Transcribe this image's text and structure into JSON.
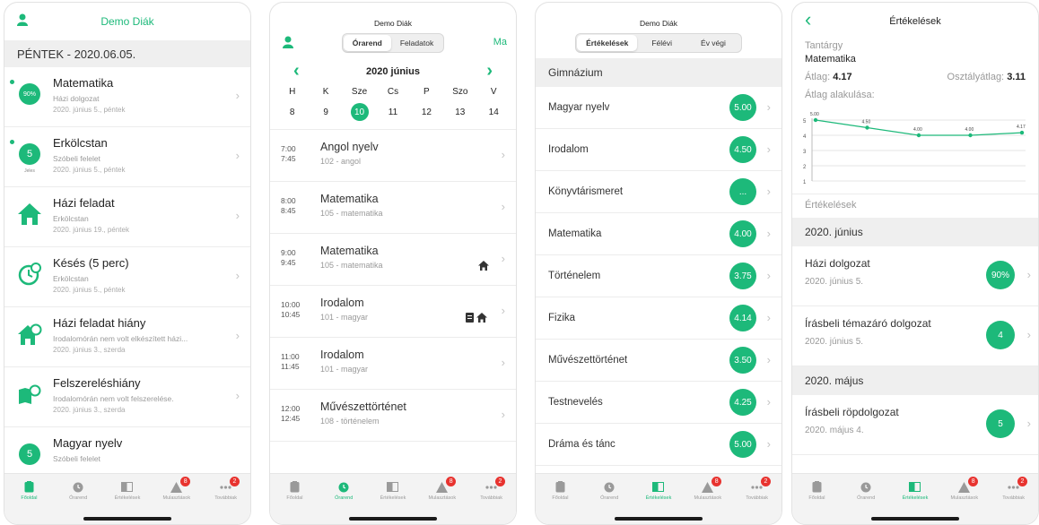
{
  "accent": "#1db97a",
  "user": "Demo Diák",
  "tabs": [
    {
      "label": "Főoldal",
      "icon": "home-icon"
    },
    {
      "label": "Órarend",
      "icon": "clock-icon"
    },
    {
      "label": "Értékelések",
      "icon": "book-icon"
    },
    {
      "label": "Mulasztások",
      "icon": "warning-icon",
      "badge": "8"
    },
    {
      "label": "Továbbiak",
      "icon": "more-icon",
      "badge": "2"
    }
  ],
  "phone1": {
    "title": "Demo Diák",
    "day": "PÉNTEK - 2020.06.05.",
    "items": [
      {
        "title": "Matematika",
        "sub": "Házi dolgozat",
        "date": "2020. június 5., péntek",
        "badge": "90%"
      },
      {
        "title": "Erkölcstan",
        "sub": "Szóbeli felelet",
        "date": "2020. június 5., péntek",
        "badge": "5",
        "badge_sub": "Jeles"
      },
      {
        "title": "Házi feladat",
        "sub": "Erkölcstan",
        "date": "2020. június 19., péntek"
      },
      {
        "title": "Késés (5 perc)",
        "sub": "Erkölcstan",
        "date": "2020. június 5., péntek"
      },
      {
        "title": "Házi feladat hiány",
        "sub": "Irodalomórán nem volt elkészített házi...",
        "date": "2020. június 3., szerda"
      },
      {
        "title": "Felszereléshiány",
        "sub": "Irodalomórán nem volt felszerelése.",
        "date": "2020. június 3., szerda"
      },
      {
        "title": "Magyar nyelv",
        "sub": "Szóbeli felelet",
        "badge": "5"
      }
    ]
  },
  "phone2": {
    "title": "Demo Diák",
    "seg": [
      "Órarend",
      "Feladatok"
    ],
    "today": "Ma",
    "month": "2020 június",
    "weekdays": [
      "H",
      "K",
      "Sze",
      "Cs",
      "P",
      "Szo",
      "V"
    ],
    "dates": [
      "8",
      "9",
      "10",
      "11",
      "12",
      "13",
      "14"
    ],
    "selected_index": 2,
    "lessons": [
      {
        "start": "7:00",
        "end": "7:45",
        "name": "Angol nyelv",
        "room": "102 - angol",
        "hw": ""
      },
      {
        "start": "8:00",
        "end": "8:45",
        "name": "Matematika",
        "room": "105 - matematika",
        "hw": ""
      },
      {
        "start": "9:00",
        "end": "9:45",
        "name": "Matematika",
        "room": "105 - matematika",
        "hw": "🏠"
      },
      {
        "start": "10:00",
        "end": "10:45",
        "name": "Irodalom",
        "room": "101 - magyar",
        "hw": "📄🏠"
      },
      {
        "start": "11:00",
        "end": "11:45",
        "name": "Irodalom",
        "room": "101 - magyar",
        "hw": ""
      },
      {
        "start": "12:00",
        "end": "12:45",
        "name": "Művészettörténet",
        "room": "108 - történelem",
        "hw": ""
      }
    ]
  },
  "phone3": {
    "title": "Demo Diák",
    "seg": [
      "Értékelések",
      "Félévi",
      "Év végi"
    ],
    "school": "Gimnázium",
    "subjects": [
      {
        "name": "Magyar nyelv",
        "avg": "5.00"
      },
      {
        "name": "Irodalom",
        "avg": "4.50"
      },
      {
        "name": "Könyvtárismeret",
        "avg": "..."
      },
      {
        "name": "Matematika",
        "avg": "4.00"
      },
      {
        "name": "Történelem",
        "avg": "3.75"
      },
      {
        "name": "Fizika",
        "avg": "4.14"
      },
      {
        "name": "Művészettörténet",
        "avg": "3.50"
      },
      {
        "name": "Testnevelés",
        "avg": "4.25"
      },
      {
        "name": "Dráma és tánc",
        "avg": "5.00"
      }
    ]
  },
  "phone4": {
    "title": "Értékelések",
    "subject_label": "Tantárgy",
    "subject": "Matematika",
    "avg_label": "Átlag:",
    "avg": "4.17",
    "class_avg_label": "Osztályátlag:",
    "class_avg": "3.11",
    "trend_label": "Átlag alakulása:",
    "grades_label": "Értékelések",
    "chart_data": {
      "type": "line",
      "values": [
        5.0,
        4.5,
        4.0,
        4.0,
        4.17
      ],
      "labels": [
        "5.00",
        "4.50",
        "4.00",
        "4.00",
        "4.17"
      ],
      "ylim": [
        1,
        5
      ],
      "yticks": [
        "5",
        "4",
        "3",
        "2",
        "1"
      ]
    },
    "groups": [
      {
        "month": "2020. június",
        "grades": [
          {
            "title": "Házi dolgozat",
            "date": "2020. június 5.",
            "value": "90%"
          },
          {
            "title": "Írásbeli témazáró dolgozat",
            "date": "2020. június 5.",
            "value": "4"
          }
        ]
      },
      {
        "month": "2020. május",
        "grades": [
          {
            "title": "Írásbeli röpdolgozat",
            "date": "2020. május 4.",
            "value": "5"
          }
        ]
      }
    ]
  }
}
